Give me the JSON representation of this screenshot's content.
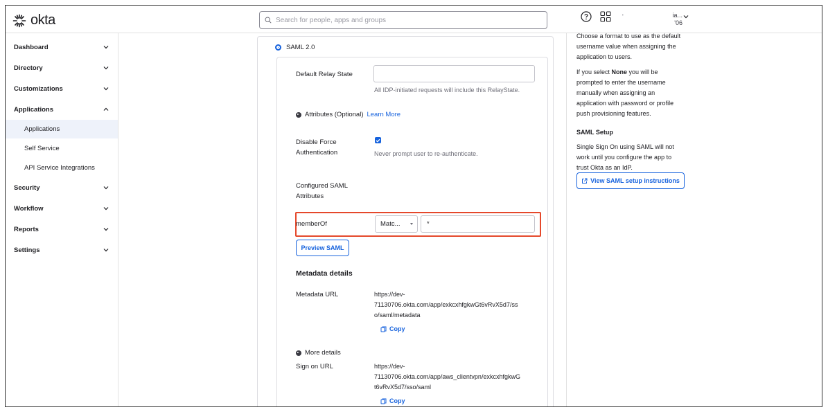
{
  "header": {
    "logo_text": "okta",
    "search_placeholder": "Search for people, apps and groups",
    "user_line1": "ia...",
    "user_line2": "'06",
    "user_tick": "'"
  },
  "sidebar": {
    "items": [
      {
        "label": "Dashboard",
        "chevron": "down"
      },
      {
        "label": "Directory",
        "chevron": "down"
      },
      {
        "label": "Customizations",
        "chevron": "down"
      },
      {
        "label": "Applications",
        "chevron": "up"
      },
      {
        "label": "Security",
        "chevron": "down"
      },
      {
        "label": "Workflow",
        "chevron": "down"
      },
      {
        "label": "Reports",
        "chevron": "down"
      },
      {
        "label": "Settings",
        "chevron": "down"
      }
    ],
    "subitems": [
      {
        "label": "Applications",
        "active": true
      },
      {
        "label": "Self Service",
        "active": false
      },
      {
        "label": "API Service Integrations",
        "active": false
      }
    ]
  },
  "form": {
    "saml_option": "SAML 2.0",
    "relay_state_label": "Default Relay State",
    "relay_state_value": "",
    "relay_state_help": "All IDP-initiated requests will include this RelayState.",
    "attributes_label": "Attributes (Optional)",
    "learn_more": "Learn More",
    "disable_force_label_1": "Disable Force",
    "disable_force_label_2": "Authentication",
    "disable_force_checked": true,
    "disable_force_help": "Never prompt user to re-authenticate.",
    "configured_saml_1": "Configured SAML",
    "configured_saml_2": "Attributes",
    "attr_name": "memberOf",
    "attr_match": "Matc...",
    "attr_value": "*",
    "preview_button": "Preview SAML",
    "metadata_heading": "Metadata details",
    "metadata_url_label": "Metadata URL",
    "metadata_url_line1": "https://dev-",
    "metadata_url_line2": "71130706.okta.com/app/exkcxhfgkwGt6vRvX5d7/ss",
    "metadata_url_line3": "o/saml/metadata",
    "copy_label": "Copy",
    "more_details": "More details",
    "sign_on_label": "Sign on URL",
    "sign_on_line1": "https://dev-",
    "sign_on_line2": "71130706.okta.com/app/aws_clientvpn/exkcxhfgkwG",
    "sign_on_line3": "t6vRvX5d7/sso/saml"
  },
  "help_panel": {
    "p1_lines": [
      "Choose a format to use as the default",
      "username value when assigning the",
      "application to users."
    ],
    "p2_prefix": "If you select ",
    "p2_bold": "None",
    "p2_suffix": " you will be",
    "p2_lines": [
      "prompted to enter the username",
      "manually when assigning an",
      "application with password or profile",
      "push provisioning features."
    ],
    "saml_setup_title": "SAML Setup",
    "p3_lines": [
      "Single Sign On using SAML will not",
      "work until you configure the app to",
      "trust Okta as an IdP."
    ],
    "view_button": "View SAML setup instructions"
  },
  "colors": {
    "accent": "#1662dd",
    "highlight_box": "#e5482b",
    "active_nav_bg": "#eef2fa"
  }
}
